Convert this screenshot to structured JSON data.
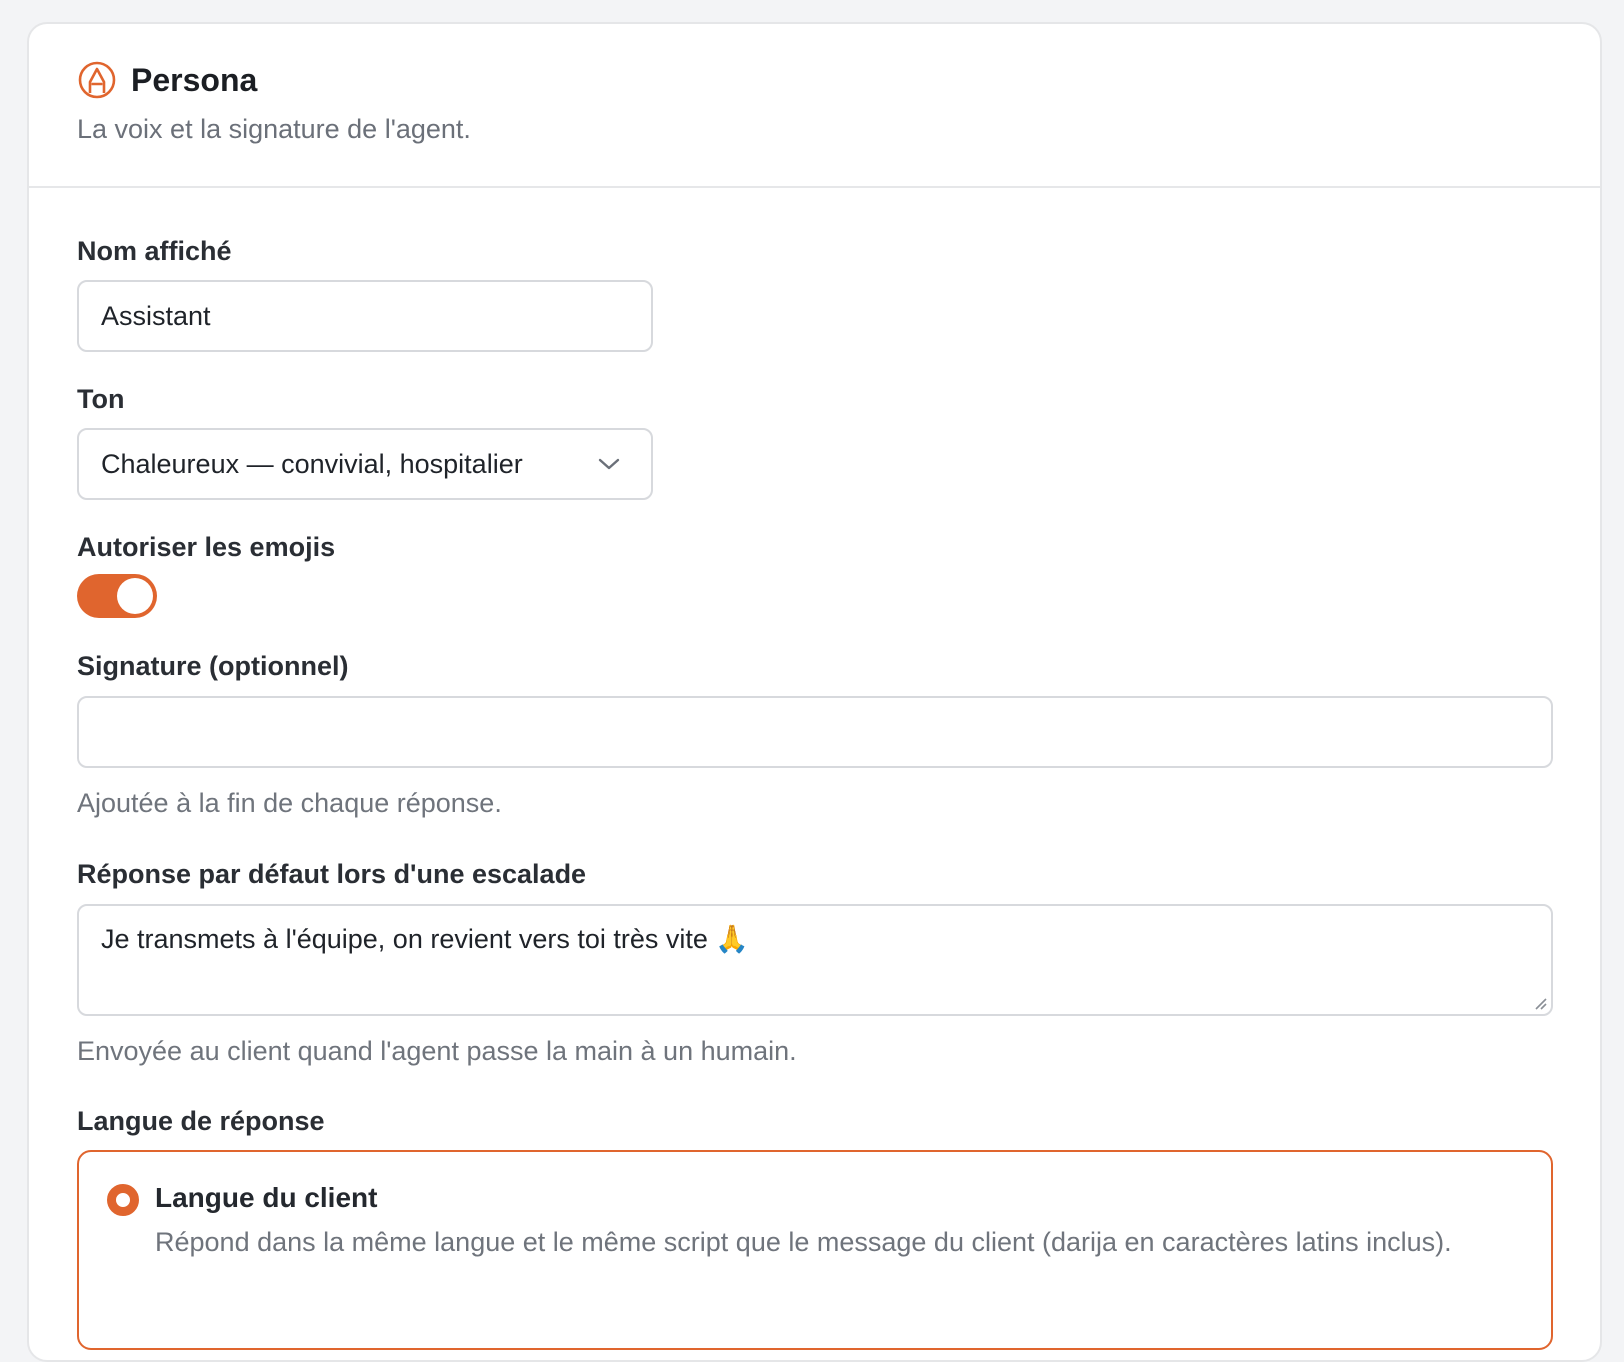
{
  "header": {
    "title": "Persona",
    "subtitle": "La voix et la signature de l'agent.",
    "icon": "persona-icon"
  },
  "fields": {
    "display_name": {
      "label": "Nom affiché",
      "value": "Assistant"
    },
    "tone": {
      "label": "Ton",
      "value": "Chaleureux — convivial, hospitalier"
    },
    "emojis": {
      "label": "Autoriser les emojis",
      "enabled": true
    },
    "signature": {
      "label": "Signature (optionnel)",
      "value": "",
      "help": "Ajoutée à la fin de chaque réponse."
    },
    "escalation": {
      "label": "Réponse par défaut lors d'une escalade",
      "value": "Je transmets à l'équipe, on revient vers toi très vite 🙏",
      "help": "Envoyée au client quand l'agent passe la main à un humain."
    },
    "language": {
      "label": "Langue de réponse",
      "options": [
        {
          "title": "Langue du client",
          "description": "Répond dans la même langue et le même script que le message du client (darija en caractères latins inclus).",
          "selected": true
        }
      ]
    }
  },
  "colors": {
    "accent": "#e0652e",
    "border": "#d7d9dd",
    "muted_text": "#6f747c"
  }
}
